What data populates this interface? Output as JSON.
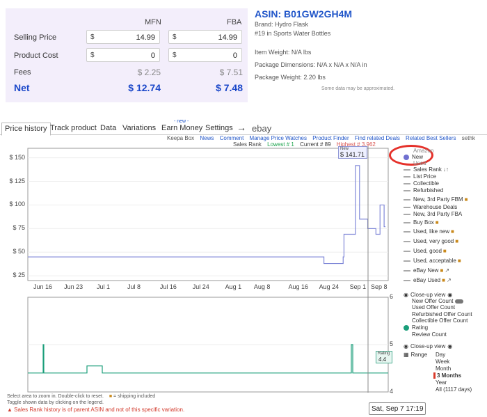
{
  "calculator": {
    "col_mfn": "MFN",
    "col_fba": "FBA",
    "selling_price_label": "Selling Price",
    "product_cost_label": "Product Cost",
    "fees_label": "Fees",
    "net_label": "Net",
    "currency": "$",
    "selling_price_mfn": "14.99",
    "selling_price_fba": "14.99",
    "product_cost_mfn": "0",
    "product_cost_fba": "0",
    "fees_mfn": "$ 2.25",
    "fees_fba": "$ 7.51",
    "net_mfn": "$ 12.74",
    "net_fba": "$ 7.48"
  },
  "product": {
    "asin": "ASIN: B01GW2GH4M",
    "brand": "Brand: Hydro Flask",
    "rank": "#19 in Sports Water Bottles",
    "weight": "Item Weight: N/A lbs",
    "dimensions": "Package Dimensions: N/A x N/A x N/A in",
    "package_weight": "Package Weight: 2.20 lbs",
    "note": "Some data may be approximated."
  },
  "tabs": {
    "new_badge": "- new -",
    "items": [
      "Price history",
      "Track product",
      "Data",
      "Variations",
      "Earn Money",
      "Settings"
    ],
    "arrow": "→",
    "ebay": "ebay"
  },
  "links": {
    "keepa_box": "Keepa Box",
    "news": "News",
    "comment": "Comment",
    "manage": "Manage Price Watches",
    "finder": "Product Finder",
    "deals": "Find related Deals",
    "best": "Related Best Sellers",
    "sethk": "sethk"
  },
  "stats": {
    "sales_rank": "Sales Rank",
    "lowest": "Lowest # 1",
    "current": "Current # 89",
    "highest": "Highest # 3,962"
  },
  "chart_data": [
    {
      "type": "line",
      "x_ticks": [
        "Jun 16",
        "Jun 23",
        "Jul 1",
        "Jul 8",
        "Jul 16",
        "Jul 24",
        "Aug 1",
        "Aug 8",
        "Aug 16",
        "Aug 24",
        "Sep 1",
        "Sep 8"
      ],
      "y_ticks": [
        "$ 150",
        "$ 125",
        "$ 100",
        "$ 75",
        "$ 50",
        "$ 25"
      ],
      "ylim": [
        20,
        160
      ],
      "series": [
        {
          "name": "New",
          "color": "#8088d8",
          "x": [
            0,
            70,
            72,
            72.3,
            77,
            77.2,
            80,
            81,
            83,
            85,
            86,
            87
          ],
          "y": [
            44.99,
            44.99,
            44.99,
            38,
            44.99,
            69,
            141.71,
            85,
            75,
            69,
            100,
            77
          ]
        }
      ],
      "hover": {
        "label": "New",
        "value": "$ 141.71"
      }
    },
    {
      "type": "line",
      "y_ticks": [
        "6",
        "5",
        "4"
      ],
      "ylim": [
        4,
        6
      ],
      "series": [
        {
          "name": "Rating",
          "color": "#1a9e7a",
          "x": [
            0,
            87
          ],
          "y": [
            4.4,
            4.4
          ]
        }
      ],
      "hover": {
        "label": "Rating",
        "value": "4.4"
      }
    }
  ],
  "legend": {
    "amazon": "Amazon",
    "new": "New",
    "used": "Used",
    "sales_rank": "Sales Rank",
    "list_price": "List Price",
    "collectible": "Collectible",
    "refurbished": "Refurbished",
    "new_3p_fbm": "New, 3rd Party FBM",
    "warehouse": "Warehouse Deals",
    "new_3p_fba": "New, 3rd Party FBA",
    "buy_box": "Buy Box",
    "used_like_new": "Used, like new",
    "used_very_good": "Used, very good",
    "used_good": "Used, good",
    "used_acceptable": "Used, acceptable",
    "ebay_new": "eBay New",
    "ebay_used": "eBay Used",
    "closeup_view": "Close-up view",
    "new_offer_count": "New Offer Count",
    "used_offer_count": "Used Offer Count",
    "refurb_offer_count": "Refurbished Offer Count",
    "collectible_offer_count": "Collectible Offer Count",
    "rating": "Rating",
    "review_count": "Review Count",
    "closeup_view_2": "Close-up view",
    "range": "Range",
    "new_color": "#7070d0",
    "rating_color": "#1a9e7a"
  },
  "range": {
    "options": [
      "Day",
      "Week",
      "Month",
      "3 Months",
      "Year",
      "All (1117 days)"
    ],
    "selected": "3 Months"
  },
  "date_tip": "Sat, Sep 7 17:19",
  "footer": {
    "line1": "Select area to zoom in. Double-click to reset.",
    "shipping": "= shipping included",
    "line2": "Toggle shown data by clicking on the legend.",
    "line3": "Sales Rank history is of parent ASIN and not of this specific variation."
  }
}
